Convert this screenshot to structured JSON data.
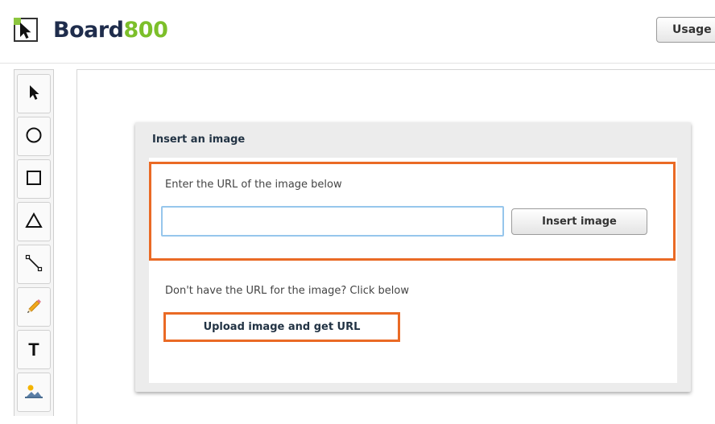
{
  "app": {
    "name_part1": "Board",
    "name_part2": "800"
  },
  "header": {
    "usage_button": "Usage"
  },
  "toolbar": {
    "tools": [
      {
        "name": "select-arrow-icon",
        "label": ""
      },
      {
        "name": "circle-icon",
        "label": ""
      },
      {
        "name": "square-icon",
        "label": ""
      },
      {
        "name": "triangle-icon",
        "label": ""
      },
      {
        "name": "line-icon",
        "label": ""
      },
      {
        "name": "pencil-icon",
        "label": ""
      },
      {
        "name": "text-icon",
        "label": "T"
      },
      {
        "name": "image-icon",
        "label": ""
      }
    ]
  },
  "dialog": {
    "title": "Insert an image",
    "url_label": "Enter the URL of the image below",
    "url_value": "",
    "url_placeholder": "",
    "insert_button": "Insert image",
    "upload_label": "Don't have the URL for the image? Click below",
    "upload_button": "Upload image and get URL"
  },
  "colors": {
    "brand_dark": "#1f2d4c",
    "brand_green": "#7cbf2a",
    "highlight": "#ea6a25",
    "input_border": "#96c6ec"
  }
}
